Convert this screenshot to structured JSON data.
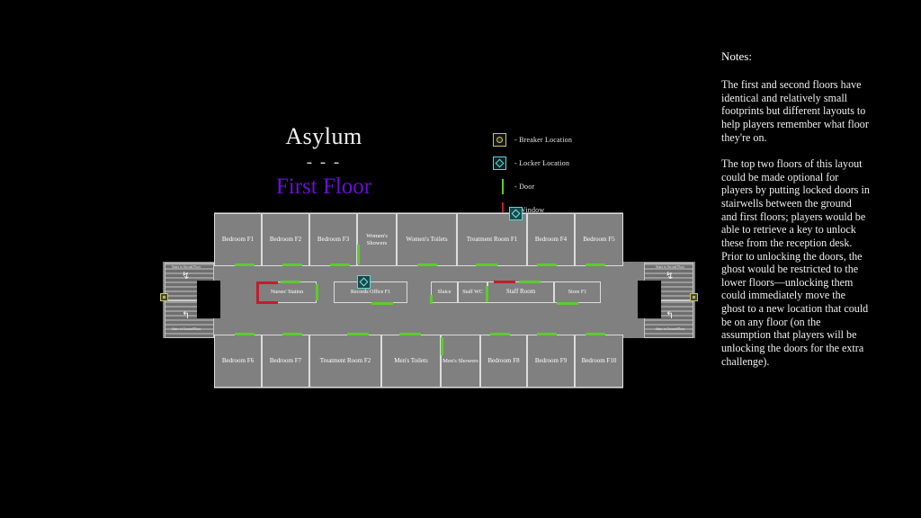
{
  "map": {
    "title": "Asylum",
    "divider": "- - -",
    "subtitle": "First Floor",
    "subtitle_color": "#6a0fd8"
  },
  "legend": {
    "items": [
      {
        "icon": "breaker-icon",
        "label": "- Breaker Location",
        "color": "#c9c36a"
      },
      {
        "icon": "locker-icon",
        "label": "- Locker Location",
        "color": "#5fd7d7"
      },
      {
        "icon": "door-icon",
        "label": "- Door",
        "color": "#5ecb2e"
      },
      {
        "icon": "window-icon",
        "label": "- Window",
        "color": "#c01d2e"
      }
    ]
  },
  "floorplan": {
    "top_rooms": [
      "Bedroom F1",
      "Bedroom F2",
      "Bedroom F3",
      "Women's Showers",
      "Women's Toilets",
      "Treatment Room F1",
      "Bedroom F4",
      "Bedroom F5"
    ],
    "middle_left_rooms": [
      "Nurses' Station",
      "Records Office F1"
    ],
    "middle_right_rooms": [
      "Sluice",
      "Staff WC",
      "Staff Room",
      "Store F1"
    ],
    "bottom_rooms": [
      "Bedroom F6",
      "Bedroom F7",
      "Treatment Room F2",
      "Men's Toilets",
      "Men's Showers",
      "Bedroom F8",
      "Bedroom F9",
      "Bedroom F10"
    ],
    "stairwells": {
      "up_label": "Stairs to Second Floor",
      "down_label": "Stairs to Ground Floor"
    },
    "markers": {
      "locker": "Locker Location",
      "breaker": "Breaker Location"
    }
  },
  "notes": {
    "heading": "Notes:",
    "paragraphs": [
      "The first and second floors have identical and relatively small footprints but different layouts to help players remember what floor they're on.",
      "The top two floors of this layout could be made optional for players by putting locked doors in stairwells between the ground and first floors; players would be able to retrieve a key to unlock these from the reception desk. Prior to unlocking the doors, the ghost would be restricted to the lower floors—unlocking them could immediately move the ghost to a new location that could be on any floor (on the assumption that players will be unlocking the doors for the extra challenge)."
    ]
  }
}
